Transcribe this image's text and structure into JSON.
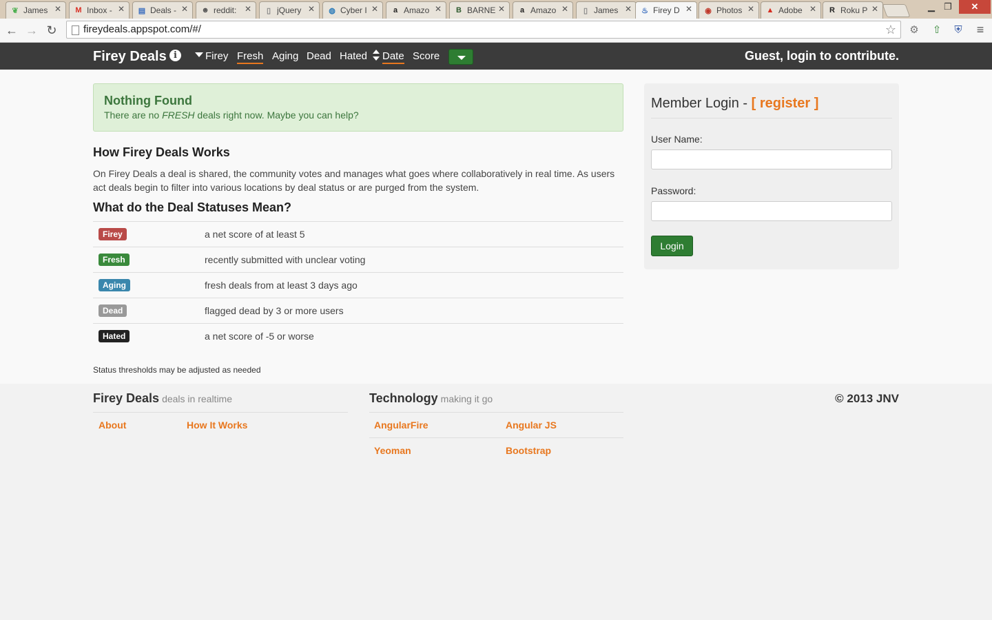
{
  "browser": {
    "tabs": [
      {
        "title": "James",
        "icon": "leaf-icon",
        "color": "#4caf50"
      },
      {
        "title": "Inbox -",
        "icon": "gmail-icon",
        "color": "#d93025"
      },
      {
        "title": "Deals -",
        "icon": "sheet-icon",
        "color": "#3b6ebf"
      },
      {
        "title": "reddit:",
        "icon": "reddit-icon",
        "color": "#555555"
      },
      {
        "title": "jQuery",
        "icon": "page-icon",
        "color": "#888888"
      },
      {
        "title": "Cyber I",
        "icon": "cyber-icon",
        "color": "#2a7ab9"
      },
      {
        "title": "Amazo",
        "icon": "amazon-icon",
        "color": "#222222"
      },
      {
        "title": "BARNE",
        "icon": "bn-icon",
        "color": "#2e5a2e"
      },
      {
        "title": "Amazo",
        "icon": "amazon-icon",
        "color": "#222222"
      },
      {
        "title": "James",
        "icon": "page-icon",
        "color": "#888888"
      },
      {
        "title": "Firey D",
        "icon": "firey-icon",
        "color": "#3b6ebf"
      },
      {
        "title": "Photos",
        "icon": "photos-icon",
        "color": "#c0392b"
      },
      {
        "title": "Adobe",
        "icon": "adobe-icon",
        "color": "#d62d20"
      },
      {
        "title": "Roku P",
        "icon": "roku-icon",
        "color": "#222222"
      }
    ],
    "url": "fireydeals.appspot.com/#/"
  },
  "navbar": {
    "brand": "Firey Deals",
    "links": {
      "firey": "Firey",
      "fresh": "Fresh",
      "aging": "Aging",
      "dead": "Dead",
      "hated": "Hated",
      "date": "Date",
      "score": "Score"
    },
    "guest": "Guest, login to contribute."
  },
  "alert": {
    "title": "Nothing Found",
    "text_before": "There are no ",
    "text_em": "FRESH",
    "text_after": " deals right now. Maybe you can help?"
  },
  "how": {
    "heading": "How Firey Deals Works",
    "body": "On Firey Deals a deal is shared, the community votes and manages what goes where collaboratively in real time. As users act deals begin to filter into various locations by deal status or are purged from the system."
  },
  "statuses": {
    "heading": "What do the Deal Statuses Mean?",
    "rows": [
      {
        "label": "Firey",
        "desc": "a net score of at least 5",
        "color": "#b94a48"
      },
      {
        "label": "Fresh",
        "desc": "recently submitted with unclear voting",
        "color": "#3a8a3c"
      },
      {
        "label": "Aging",
        "desc": "fresh deals from at least 3 days ago",
        "color": "#3a87ad"
      },
      {
        "label": "Dead",
        "desc": "flagged dead by 3 or more users",
        "color": "#999999"
      },
      {
        "label": "Hated",
        "desc": "a net score of -5 or worse",
        "color": "#222222"
      }
    ],
    "note": "Status thresholds may be adjusted as needed"
  },
  "login": {
    "title": "Member Login - ",
    "register": "[ register ]",
    "username_label": "User Name:",
    "password_label": "Password:",
    "button": "Login"
  },
  "footer": {
    "brand": "Firey Deals",
    "brand_sub": "deals in realtime",
    "links1": [
      "About",
      "How It Works"
    ],
    "tech": "Technology",
    "tech_sub": "making it go",
    "tech_links": [
      "AngularFire",
      "Angular JS",
      "Yeoman",
      "Bootstrap"
    ],
    "copyright": "© 2013 JNV"
  },
  "colors": {
    "accent": "#e8771e",
    "navbar": "#3b3b3b",
    "button_green": "#2e7d32"
  }
}
